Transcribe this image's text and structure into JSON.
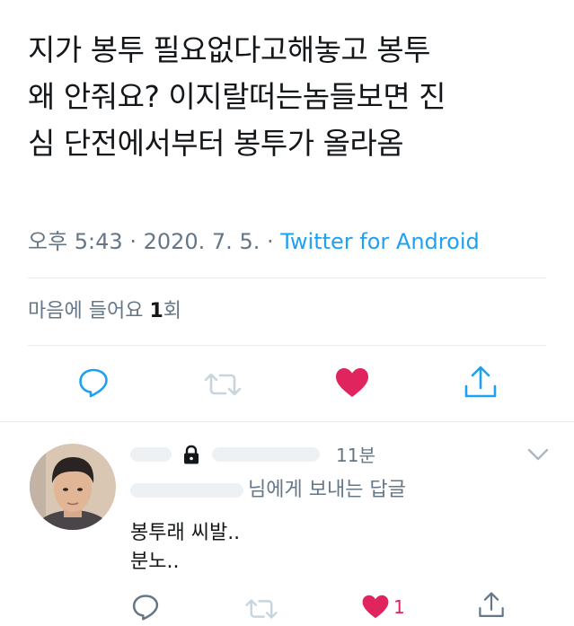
{
  "tweet": {
    "text": "지가 봉투 필요없다고해놓고 봉투\n왜 안줘요? 이지랄떠는놈들보면 진\n심 단전에서부터 봉투가 올라옴",
    "time": "오후 5:43",
    "sep1": " · ",
    "date": "2020. 7. 5.",
    "sep2": " · ",
    "source": "Twitter for Android",
    "likes_prefix": "마음에 들어요 ",
    "likes_count": "1",
    "likes_suffix": "회"
  },
  "reply": {
    "time": "11분",
    "reply_to_suffix": "님에게 보내는 답글",
    "text": "봉투래 씨발..\n분노..",
    "like_count": "1"
  },
  "icons": {
    "reply": "reply-icon",
    "retweet": "retweet-icon",
    "like": "heart-icon",
    "share": "share-icon",
    "lock": "lock-icon",
    "more": "chevron-down-icon"
  },
  "colors": {
    "text": "#14171a",
    "muted": "#657786",
    "link": "#1da1f2",
    "like": "#e0245e",
    "divider": "#e6ecf0"
  }
}
